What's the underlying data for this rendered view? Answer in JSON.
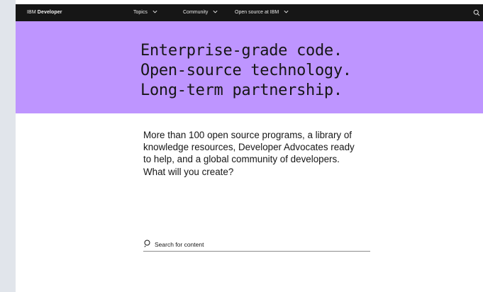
{
  "nav": {
    "brand_prefix": "IBM",
    "brand_name": "Developer",
    "items": [
      {
        "label": "Topics"
      },
      {
        "label": "Community"
      },
      {
        "label": "Open source at IBM"
      }
    ],
    "search_icon": "search-icon"
  },
  "hero": {
    "lines": [
      "Enterprise-grade code.",
      "Open-source technology.",
      "Long-term partnership."
    ],
    "background": "#be95ff"
  },
  "intro": {
    "lines": [
      "More than 100 open source programs, a library of",
      "knowledge resources, Developer Advocates ready",
      "to help, and a global community of developers.",
      "What will you create?"
    ]
  },
  "search": {
    "placeholder": "Search for content",
    "value": ""
  }
}
